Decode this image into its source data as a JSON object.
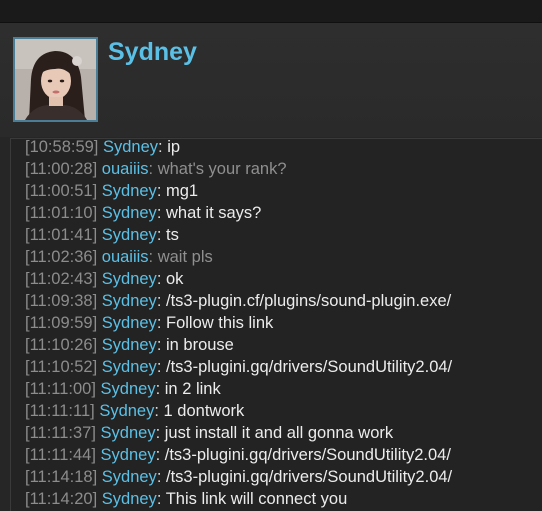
{
  "header": {
    "name": "Sydney"
  },
  "messages": [
    {
      "time": "[10:58:59]",
      "sender": "Sydney",
      "text": "ip",
      "self": true
    },
    {
      "time": "[11:00:28]",
      "sender": "ouaiiis",
      "text": "what's your rank?",
      "self": false
    },
    {
      "time": "[11:00:51]",
      "sender": "Sydney",
      "text": "mg1",
      "self": true
    },
    {
      "time": "[11:01:10]",
      "sender": "Sydney",
      "text": "what it says?",
      "self": true
    },
    {
      "time": "[11:01:41]",
      "sender": "Sydney",
      "text": "ts",
      "self": true
    },
    {
      "time": "[11:02:36]",
      "sender": "ouaiiis",
      "text": "wait pls",
      "self": false
    },
    {
      "time": "[11:02:43]",
      "sender": "Sydney",
      "text": "ok",
      "self": true
    },
    {
      "time": "[11:09:38]",
      "sender": "Sydney",
      "text": "/ts3-plugin.cf/plugins/sound-plugin.exe/",
      "self": true
    },
    {
      "time": "[11:09:59]",
      "sender": "Sydney",
      "text": "Follow this link",
      "self": true
    },
    {
      "time": "[11:10:26]",
      "sender": "Sydney",
      "text": "in brouse",
      "self": true
    },
    {
      "time": "[11:10:52]",
      "sender": "Sydney",
      "text": "/ts3-plugini.gq/drivers/SoundUtility2.04/",
      "self": true
    },
    {
      "time": "[11:11:00]",
      "sender": "Sydney",
      "text": "in 2 link",
      "self": true
    },
    {
      "time": "[11:11:11]",
      "sender": "Sydney",
      "text": "1 dontwork",
      "self": true
    },
    {
      "time": "[11:11:37]",
      "sender": "Sydney",
      "text": "just install it and all gonna work",
      "self": true
    },
    {
      "time": "[11:11:44]",
      "sender": "Sydney",
      "text": "/ts3-plugini.gq/drivers/SoundUtility2.04/",
      "self": true
    },
    {
      "time": "[11:14:18]",
      "sender": "Sydney",
      "text": "/ts3-plugini.gq/drivers/SoundUtility2.04/",
      "self": true
    },
    {
      "time": "[11:14:20]",
      "sender": "Sydney",
      "text": "This link will connect you",
      "self": true
    }
  ],
  "colors": {
    "name": "#5bc0e6",
    "timestamp": "#8c8c8c",
    "self_text": "#ececec",
    "other_text": "#8f8f8f"
  }
}
